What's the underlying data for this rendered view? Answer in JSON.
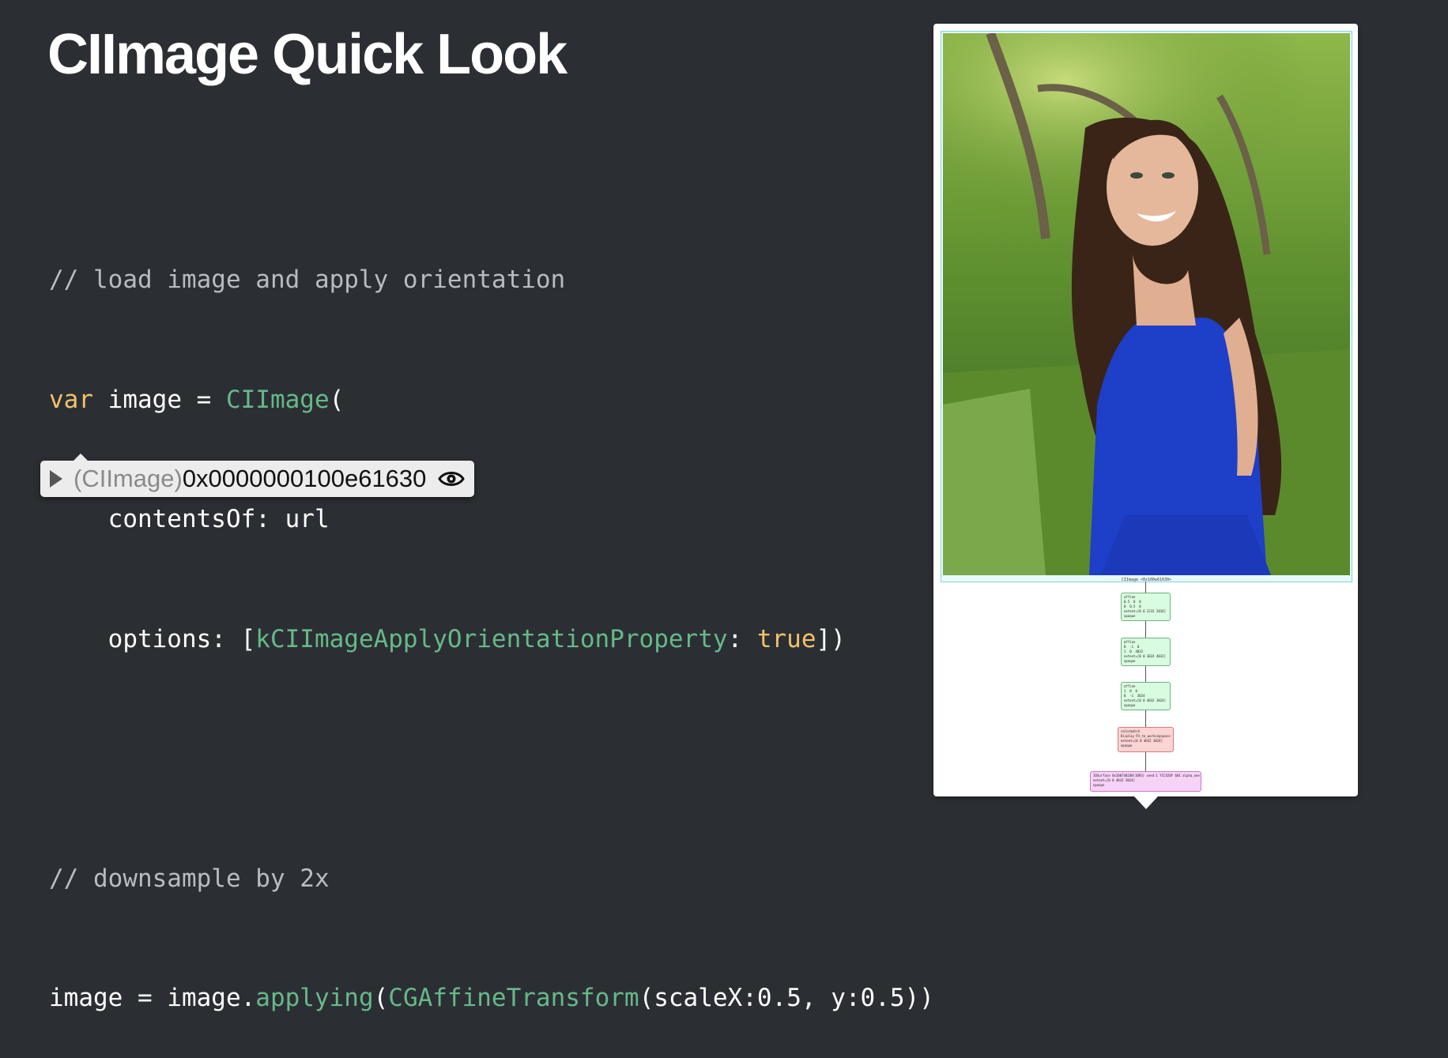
{
  "slide": {
    "title": "CIImage Quick Look"
  },
  "code": {
    "comment1": "// load image and apply orientation",
    "line_var": "var",
    "line_image_eq": " image = ",
    "line_ciimage": "CIImage",
    "line_open": "(",
    "line_contents": "    contentsOf: url",
    "line_options": "    options: [",
    "line_orientation_key": "kCIImageApplyOrientationProperty",
    "line_colon": ": ",
    "line_true": "true",
    "line_close": "])",
    "comment2": "// downsample by 2x",
    "line_image_assign": "image = image.",
    "line_applying": "applying",
    "line_paren": "(",
    "line_cgaffine": "CGAffineTransform",
    "line_args": "(scaleX:0.5, y:0.5))"
  },
  "inspector": {
    "type": "(CIImage)",
    "address": "0x0000000100e61630",
    "disclosure_icon": "disclosure-triangle-icon",
    "quicklook_icon": "eye-icon"
  },
  "preview": {
    "photo_label": "CIImage <0x100e61630>",
    "nodes": [
      {
        "kind": "affine",
        "text": "affine\n0.5  0  0\n0  0.5  0\nextent=[0 0 2232 2816]\nopaque",
        "color": "#d9fbe0"
      },
      {
        "kind": "affine",
        "text": "affine\n0  -1  0\n1  0  4032\nextent=[0 0 3024 4032]\nopaque",
        "color": "#d9fbe0"
      },
      {
        "kind": "affine",
        "text": "affine\n1  0  0\n0  -1  3024\nextent=[0 0 4032 3024]\nopaque",
        "color": "#d9fbe0"
      },
      {
        "kind": "colormatch",
        "text": "colormatch\nDisplay P3_to_workingspace\nextent=[0 0 4032 3024]\nopaque",
        "color": "#fdd4d4"
      },
      {
        "kind": "iosurface",
        "text": "IOSurface 0x1007402d0(1093) seed:1 YCC420f 601 alpha_one\nextent=[0 0 4032 3024]\nopaque",
        "color": "#f7d2f7"
      }
    ]
  },
  "colors": {
    "background": "#2b2f33",
    "comment": "#b7bcc0",
    "keyword": "#f2c16c",
    "type": "#67b88a"
  }
}
